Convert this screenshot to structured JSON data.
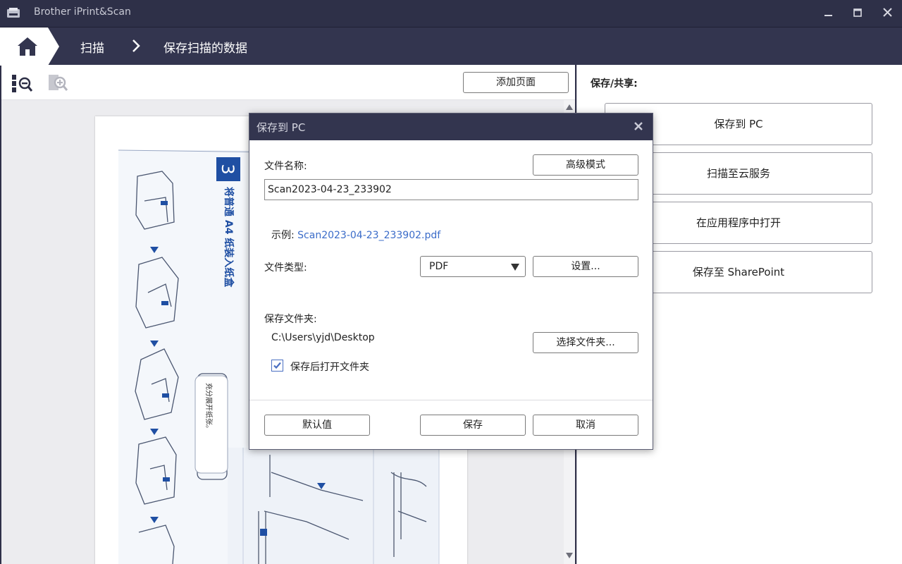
{
  "app": {
    "title": "Brother iPrint&Scan",
    "icon": "scanner-icon"
  },
  "window_controls": {
    "minimize": "minimize-icon",
    "maximize": "maximize-icon",
    "close": "close-icon"
  },
  "breadcrumb": {
    "home_icon": "home-icon",
    "scan_label": "扫描",
    "current_label": "保存扫描的数据"
  },
  "toolbar": {
    "zoom_out_icon": "zoom-out-icon",
    "zoom_in_icon": "zoom-in-icon",
    "add_page_label": "添加页面"
  },
  "share_panel": {
    "heading": "保存/共享:",
    "buttons": [
      {
        "label": "保存到 PC"
      },
      {
        "label": "扫描至云服务"
      },
      {
        "label": "在应用程序中打开"
      },
      {
        "label": "保存至 SharePoint"
      }
    ]
  },
  "dialog": {
    "title": "保存到 PC",
    "file_name_label": "文件名称:",
    "advanced_mode_label": "高级模式",
    "file_name_value": "Scan2023-04-23_233902",
    "example_prefix": "示例: ",
    "example_value": "Scan2023-04-23_233902.pdf",
    "file_type_label": "文件类型:",
    "file_type_value": "PDF",
    "settings_label": "设置...",
    "folder_label": "保存文件夹:",
    "folder_path": "C:\\Users\\yjd\\Desktop",
    "choose_folder_label": "选择文件夹...",
    "open_after_save_label": "保存后打开文件夹",
    "open_after_save_checked": true,
    "default_label": "默认值",
    "save_label": "保存",
    "cancel_label": "取消"
  },
  "scanned_page": {
    "step_number": "3",
    "heading": "将普通 A4 纸装入纸盒",
    "callout": "充分展开纸张。"
  },
  "colors": {
    "title_bar": "#2e3048",
    "accent_link": "#3b6cc9",
    "checkbox": "#4a6fc2",
    "step_badge": "#1f4fa3"
  }
}
